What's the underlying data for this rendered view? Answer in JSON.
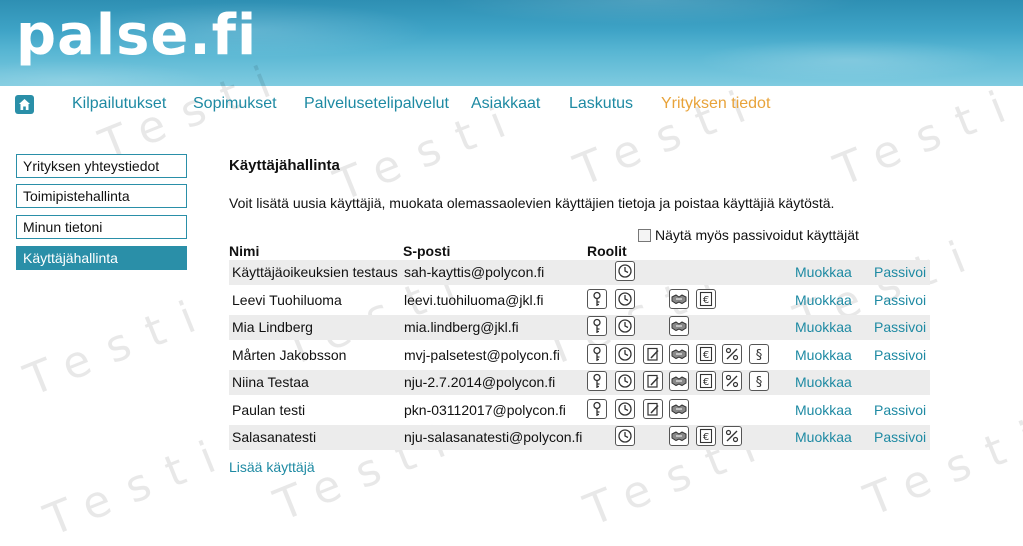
{
  "logo": "palse.fi",
  "watermark": "Testi",
  "nav": {
    "items": [
      {
        "label": "Kilpailutukset",
        "active": false
      },
      {
        "label": "Sopimukset",
        "active": false
      },
      {
        "label": "Palvelusetelipalvelut",
        "active": false
      },
      {
        "label": "Asiakkaat",
        "active": false
      },
      {
        "label": "Laskutus",
        "active": false
      },
      {
        "label": "Yrityksen tiedot",
        "active": true
      }
    ]
  },
  "sidebar": {
    "items": [
      {
        "label": "Yrityksen yhteystiedot",
        "active": false
      },
      {
        "label": "Toimipistehallinta",
        "active": false
      },
      {
        "label": "Minun tietoni",
        "active": false
      },
      {
        "label": "Käyttäjähallinta",
        "active": true
      }
    ]
  },
  "main": {
    "title": "Käyttäjähallinta",
    "description": "Voit lisätä uusia käyttäjiä, muokata olemassaolevien käyttäjien tietoja ja poistaa käyttäjiä käytöstä.",
    "show_passive_label": "Näytä myös passivoidut käyttäjät",
    "show_passive_checked": false,
    "columns": {
      "name": "Nimi",
      "email": "S-posti",
      "roles": "Roolit"
    },
    "edit_label": "Muokkaa",
    "passivate_label": "Passivoi",
    "add_user_label": "Lisää käyttäjä",
    "users": [
      {
        "name": "Käyttäjäoikeuksien testaus",
        "email": "sah-kayttis@polycon.fi",
        "roles": [
          "clock"
        ],
        "passivate": true
      },
      {
        "name": "Leevi Tuohiluoma",
        "email": "leevi.tuohiluoma@jkl.fi",
        "roles": [
          "key",
          "clock",
          "handshake",
          "euro"
        ],
        "passivate": true
      },
      {
        "name": "Mia Lindberg",
        "email": "mia.lindberg@jkl.fi",
        "roles": [
          "key",
          "clock",
          "handshake"
        ],
        "passivate": true
      },
      {
        "name": "Mårten Jakobsson",
        "email": "mvj-palsetest@polycon.fi",
        "roles": [
          "key",
          "clock",
          "edit",
          "handshake",
          "euro",
          "percent",
          "paragraph"
        ],
        "passivate": true
      },
      {
        "name": "Niina Testaa",
        "email": "nju-2.7.2014@polycon.fi",
        "roles": [
          "key",
          "clock",
          "edit",
          "handshake",
          "euro",
          "percent",
          "paragraph"
        ],
        "passivate": false
      },
      {
        "name": "Paulan testi",
        "email": "pkn-03112017@polycon.fi",
        "roles": [
          "key",
          "clock",
          "edit",
          "handshake"
        ],
        "passivate": true
      },
      {
        "name": "Salasanatesti",
        "email": "nju-salasanatesti@polycon.fi",
        "roles": [
          "clock",
          "handshake",
          "euro",
          "percent"
        ],
        "passivate": true
      }
    ]
  },
  "colors": {
    "accent": "#1e8aa3",
    "active_nav": "#e8a33a",
    "sidebar_active_bg": "#2a8fa8",
    "row_shade": "#ececec"
  }
}
